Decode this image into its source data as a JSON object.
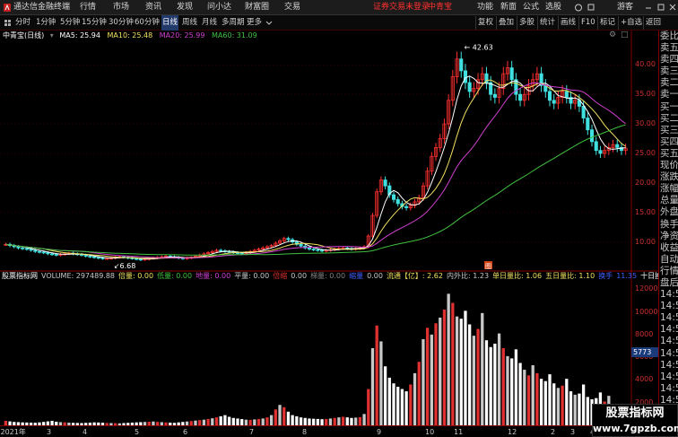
{
  "menubar": {
    "app_title": "通达信金融终端",
    "menu": [
      "行情",
      "市场",
      "资讯",
      "发现",
      "问小达",
      "财富圈",
      "交易"
    ],
    "login_status": "证券交易未登录",
    "stock_name": "中青宝",
    "right_menu": [
      "功能",
      "新面",
      "公式",
      "选股"
    ],
    "user": "游客"
  },
  "toolbar": {
    "periods": [
      "分时",
      "1分钟",
      "5分钟",
      "15分钟",
      "30分钟",
      "60分钟",
      "日线",
      "周线",
      "月线",
      "多周期",
      "更多"
    ],
    "active_period": "日线",
    "buttons": [
      "复权",
      "叠加",
      "多股",
      "统计",
      "画线",
      "F10",
      "标记",
      "+自选",
      "返回"
    ]
  },
  "ma_info": {
    "title": "中青宝(日线)",
    "items": [
      {
        "label": "MA5: 25.94",
        "color": "#ffffff"
      },
      {
        "label": "MA10: 25.48",
        "color": "#f0e060"
      },
      {
        "label": "MA20: 25.99",
        "color": "#d040d0"
      },
      {
        "label": "MA60: 31.09",
        "color": "#40c040"
      }
    ]
  },
  "volume_info": {
    "items": [
      {
        "label": "股票指标网",
        "color": "#ffffff"
      },
      {
        "label": "VOLUME: 297489.88",
        "color": "#c8c8c8"
      },
      {
        "label": "倍量: 0.00",
        "color": "#f0e060"
      },
      {
        "label": "低量: 0.00",
        "color": "#40c040"
      },
      {
        "label": "地量: 0.00",
        "color": "#d040d0"
      },
      {
        "label": "平量: 0.00",
        "color": "#c8c8c8"
      },
      {
        "label": "倍缩",
        "color": "#e03030"
      },
      {
        "label": "0.00",
        "color": "#c8c8c8"
      },
      {
        "label": "梯量: 0.00",
        "color": "#808080"
      },
      {
        "label": "缩量",
        "color": "#4060ff"
      },
      {
        "label": "0.00",
        "color": "#c8c8c8"
      },
      {
        "label": "流通【亿】: 2.62",
        "color": "#f0e060"
      },
      {
        "label": "内外比: 1.23",
        "color": "#c8c8c8"
      },
      {
        "label": "单日量比: 1.06",
        "color": "#f0e060"
      },
      {
        "label": "五日量比: 1.10",
        "color": "#f0e060"
      },
      {
        "label": "换手",
        "color": "#4060ff"
      },
      {
        "label": "11.35",
        "color": "#4060ff"
      },
      {
        "label": "十日换手",
        "color": "#ffffff"
      }
    ]
  },
  "right_panel": [
    "委比",
    "卖五",
    "卖四",
    "卖三",
    "卖二",
    "卖一",
    "买一",
    "买二",
    "买三",
    "买四",
    "买五",
    "现价",
    "涨跌",
    "涨幅",
    "总量",
    "外盘",
    "换手",
    "净资",
    "收益",
    "自动",
    "行情",
    "盘后",
    "14:5",
    "14:5",
    "14:5",
    "14:5",
    "14:5",
    "14:5",
    "14:5",
    "14:5",
    "14:5",
    "14:5",
    "14:5"
  ],
  "price_axis": [
    "40.00",
    "35.00",
    "30.00",
    "25.00",
    "20.00",
    "15.00",
    "10.00"
  ],
  "volume_axis": [
    "12000",
    "10000",
    "8000",
    "6000",
    "4000",
    "2000"
  ],
  "volume_marker": "5773",
  "dates": [
    {
      "label": "2021年",
      "pos": 0.5
    },
    {
      "label": "3",
      "pos": 52
    },
    {
      "label": "4",
      "pos": 92
    },
    {
      "label": "5",
      "pos": 150
    },
    {
      "label": "6",
      "pos": 204
    },
    {
      "label": "7",
      "pos": 278
    },
    {
      "label": "8",
      "pos": 337
    },
    {
      "label": "9",
      "pos": 420
    },
    {
      "label": "10",
      "pos": 474
    },
    {
      "label": "11",
      "pos": 506
    },
    {
      "label": "12",
      "pos": 566
    },
    {
      "label": "2",
      "pos": 614
    },
    {
      "label": "3",
      "pos": 636
    },
    {
      "label": "4",
      "pos": 658
    }
  ],
  "annotations": {
    "high": "42.63",
    "low": "6.68",
    "flag": "图"
  },
  "watermark": {
    "line1": "股票指标网",
    "line2": "www.7gpzb.com"
  },
  "chart_data": {
    "type": "candlestick-volume",
    "price_ylim": [
      6,
      44
    ],
    "volume_ylim": [
      0,
      12500
    ],
    "high_label": 42.63,
    "low_label": 6.68,
    "close_series": [
      9.6,
      9.4,
      9.2,
      9.0,
      8.9,
      8.8,
      8.6,
      8.4,
      8.3,
      8.2,
      8.0,
      7.9,
      7.8,
      7.9,
      8.0,
      8.1,
      8.0,
      7.9,
      7.8,
      7.6,
      7.5,
      7.4,
      7.3,
      7.2,
      7.2,
      7.3,
      7.4,
      7.5,
      7.4,
      7.3,
      7.2,
      7.1,
      7.0,
      7.1,
      7.2,
      7.3,
      7.4,
      7.5,
      7.6,
      7.5,
      7.4,
      7.3,
      7.2,
      7.3,
      7.4,
      7.6,
      7.8,
      8.0,
      8.2,
      8.4,
      8.6,
      8.5,
      8.4,
      8.3,
      8.2,
      8.1,
      8.0,
      8.2,
      8.4,
      8.6,
      8.8,
      9.0,
      9.2,
      9.4,
      9.8,
      10.2,
      10.6,
      10.4,
      10.0,
      9.6,
      9.3,
      9.0,
      8.8,
      8.7,
      8.6,
      8.5,
      8.6,
      8.7,
      8.8,
      8.9,
      9.0,
      8.9,
      8.8,
      8.9,
      9.0,
      9.2,
      11.0,
      14.5,
      18.5,
      20.5,
      19.5,
      18.0,
      17.2,
      16.5,
      16.0,
      15.8,
      16.2,
      16.8,
      17.5,
      19.5,
      22.0,
      24.5,
      26.0,
      27.5,
      30.0,
      34.0,
      38.0,
      41.0,
      39.0,
      37.0,
      35.5,
      36.0,
      37.5,
      38.5,
      37.0,
      35.0,
      34.5,
      36.0,
      38.5,
      39.5,
      37.5,
      35.0,
      34.0,
      35.0,
      36.5,
      37.5,
      38.5,
      36.5,
      35.5,
      34.0,
      33.5,
      34.5,
      35.5,
      34.5,
      33.5,
      34.0,
      33.0,
      31.0,
      29.0,
      27.0,
      25.5,
      25.0,
      25.5,
      26.0,
      26.5,
      26.0,
      25.5,
      25.9
    ],
    "volume_series": [
      400,
      350,
      300,
      280,
      260,
      250,
      240,
      230,
      260,
      300,
      350,
      400,
      320,
      280,
      260,
      240,
      220,
      210,
      200,
      220,
      240,
      260,
      250,
      230,
      210,
      200,
      190,
      180,
      200,
      220,
      240,
      260,
      280,
      300,
      320,
      340,
      300,
      280,
      260,
      240,
      220,
      260,
      300,
      340,
      380,
      420,
      460,
      500,
      560,
      620,
      700,
      800,
      900,
      750,
      650,
      600,
      550,
      500,
      480,
      520,
      560,
      600,
      700,
      900,
      1400,
      1800,
      1600,
      1200,
      900,
      800,
      700,
      650,
      600,
      580,
      560,
      540,
      560,
      600,
      650,
      700,
      750,
      700,
      650,
      680,
      720,
      1000,
      3200,
      6800,
      8800,
      7400,
      5200,
      4200,
      3700,
      3400,
      3200,
      3000,
      3600,
      4600,
      5600,
      7600,
      8600,
      8000,
      9000,
      9500,
      10200,
      11600,
      10800,
      9600,
      9400,
      10100,
      8900,
      7900,
      8500,
      9900,
      7500,
      6900,
      7200,
      8100,
      6800,
      6100,
      5900,
      6700,
      5500,
      4900,
      4400,
      5300,
      4600,
      4100,
      3900,
      4500,
      3700,
      3300,
      3500,
      4100,
      3000,
      2700,
      2800,
      3600,
      2500,
      2300,
      2400,
      2900,
      2100,
      2600
    ]
  }
}
